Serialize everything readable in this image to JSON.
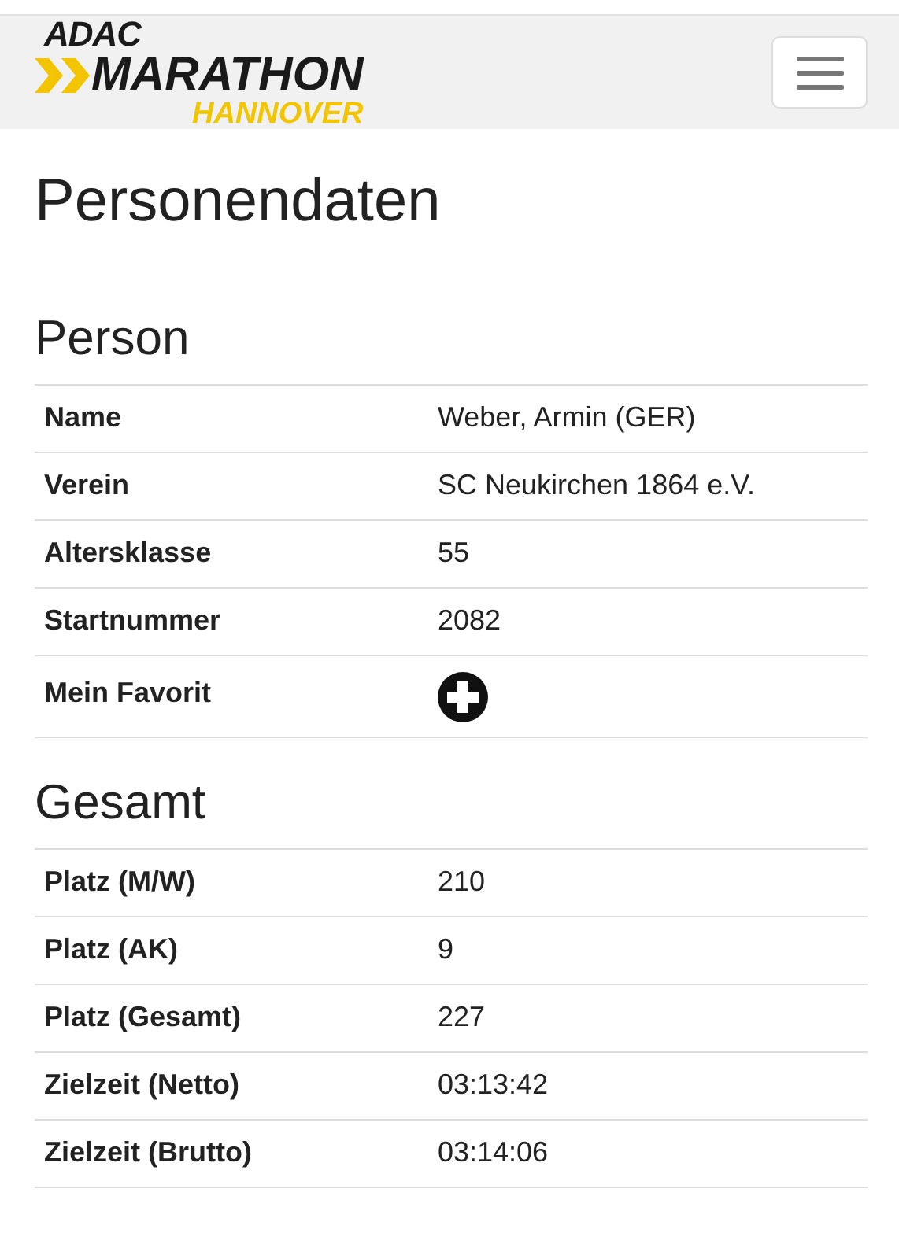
{
  "logo": {
    "line_1": "ADAC",
    "line_2": "MARATHON",
    "line_3": "HANNOVER"
  },
  "page_title": "Personendaten",
  "sections": [
    {
      "title": "Person",
      "rows": [
        {
          "kind": "text",
          "label": "Name",
          "value": "Weber, Armin (GER)"
        },
        {
          "kind": "text",
          "label": "Verein",
          "value": "SC Neukirchen 1864 e.V."
        },
        {
          "kind": "text",
          "label": "Altersklasse",
          "value": "55"
        },
        {
          "kind": "text",
          "label": "Startnummer",
          "value": "2082"
        },
        {
          "kind": "favorite",
          "label": "Mein Favorit"
        }
      ]
    },
    {
      "title": "Gesamt",
      "rows": [
        {
          "kind": "text",
          "label": "Platz (M/W)",
          "value": "210"
        },
        {
          "kind": "text",
          "label": "Platz (AK)",
          "value": "9"
        },
        {
          "kind": "text",
          "label": "Platz (Gesamt)",
          "value": "227"
        },
        {
          "kind": "text",
          "label": "Zielzeit (Netto)",
          "value": "03:13:42"
        },
        {
          "kind": "text",
          "label": "Zielzeit (Brutto)",
          "value": "03:14:06"
        }
      ]
    }
  ]
}
